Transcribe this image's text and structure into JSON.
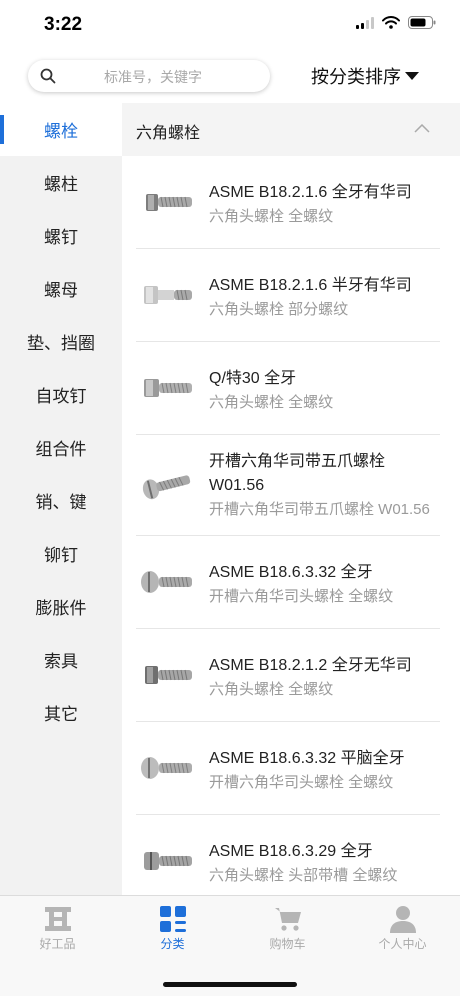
{
  "status_bar": {
    "time": "3:22"
  },
  "search": {
    "placeholder": "标准号，关键字",
    "sort_label": "按分类排序"
  },
  "sidebar": {
    "items": [
      {
        "label": "螺栓",
        "active": true
      },
      {
        "label": "螺柱"
      },
      {
        "label": "螺钉"
      },
      {
        "label": "螺母"
      },
      {
        "label": "垫、挡圈"
      },
      {
        "label": "自攻钉"
      },
      {
        "label": "组合件"
      },
      {
        "label": "销、键"
      },
      {
        "label": "铆钉"
      },
      {
        "label": "膨胀件"
      },
      {
        "label": "索具"
      },
      {
        "label": "其它"
      }
    ]
  },
  "section": {
    "title": "六角螺栓"
  },
  "products": [
    {
      "name": "ASME B18.2.1.6 全牙有华司",
      "desc": "六角头螺栓 全螺纹",
      "thumb": "hex-bolt-full-thread-icon"
    },
    {
      "name": "ASME B18.2.1.6 半牙有华司",
      "desc": "六角头螺栓 部分螺纹",
      "thumb": "hex-bolt-partial-thread-icon"
    },
    {
      "name": "Q/特30 全牙",
      "desc": "六角头螺栓 全螺纹",
      "thumb": "hex-bolt-icon"
    },
    {
      "name_lines": [
        "开槽六角华司带五爪螺栓",
        "W01.56"
      ],
      "desc": "开槽六角华司带五爪螺栓 W01.56",
      "thumb": "slotted-claw-bolt-icon"
    },
    {
      "name": "ASME B18.6.3.32 全牙",
      "desc": "开槽六角华司头螺栓 全螺纹",
      "thumb": "slotted-washer-head-bolt-icon"
    },
    {
      "name": "ASME B18.2.1.2 全牙无华司",
      "desc": "六角头螺栓 全螺纹",
      "thumb": "hex-bolt-no-washer-icon"
    },
    {
      "name": "ASME B18.6.3.32 平脑全牙",
      "desc": "开槽六角华司头螺栓 全螺纹",
      "thumb": "flat-head-slotted-bolt-icon"
    },
    {
      "name": "ASME B18.6.3.29 全牙",
      "desc": "六角头螺栓 头部带槽 全螺纹",
      "thumb": "slotted-hex-bolt-icon"
    }
  ],
  "tabbar": {
    "tabs": [
      {
        "label": "好工品",
        "icon": "brand-logo-icon"
      },
      {
        "label": "分类",
        "icon": "category-grid-icon",
        "active": true
      },
      {
        "label": "购物车",
        "icon": "shopping-cart-icon"
      },
      {
        "label": "个人中心",
        "icon": "person-icon"
      }
    ]
  },
  "colors": {
    "accent": "#1e6fd9",
    "sidebar_bg": "#f2f2f2",
    "muted": "#9a9a9a"
  }
}
